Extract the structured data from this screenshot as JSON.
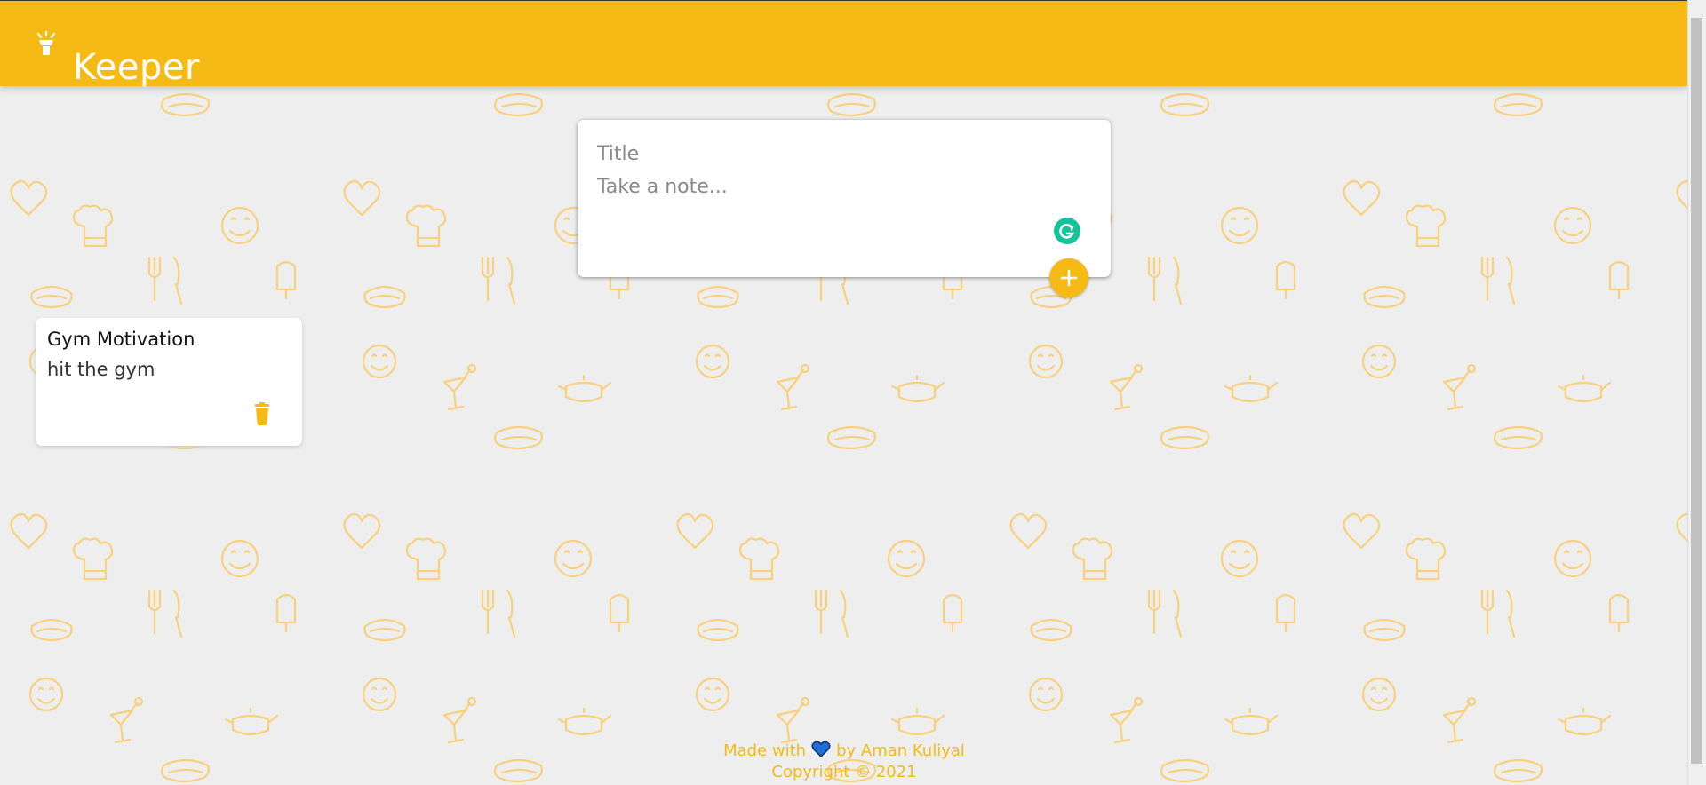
{
  "app": {
    "brand": "Keeper",
    "logo_icon": "lightbulb-icon",
    "accent_color": "#f5ba13"
  },
  "composer": {
    "title_placeholder": "Title",
    "content_placeholder": "Take a note...",
    "add_icon": "plus-icon",
    "extension_icon": "grammarly-icon"
  },
  "notes": [
    {
      "title": "Gym Motivation",
      "content": "hit the gym",
      "delete_icon": "trash-icon"
    }
  ],
  "footer": {
    "made_with_prefix": "Made with",
    "heart_icon": "heart-icon",
    "made_with_suffix": "by Aman Kuliyal",
    "copyright": "Copyright © 2021"
  }
}
